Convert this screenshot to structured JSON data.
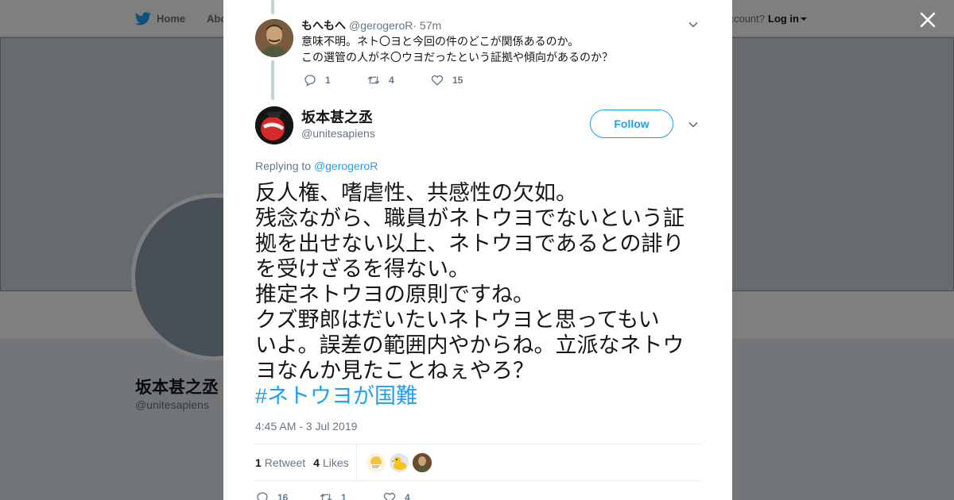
{
  "nav": {
    "home_label": "Home",
    "about_label": "Abo"
  },
  "account": {
    "prompt": "account?",
    "login_label": "Log in"
  },
  "profile": {
    "name": "坂本甚之丞",
    "handle": "@unitesapiens"
  },
  "reply": {
    "name": "もへもへ",
    "handle": "@gerogeroR",
    "time": " · 57m",
    "text_line1": "意味不明。ネト〇ヨと今回の件のどこが関係あるのか。",
    "text_line2": "この選管の人がネ〇ウヨだったという証拠や傾向があるのか？",
    "reply_count": "1",
    "retweet_count": "4",
    "like_count": "15"
  },
  "tweet": {
    "name": "坂本甚之丞",
    "handle": "@unitesapiens",
    "follow_label": "Follow",
    "replying_prefix": "Replying to ",
    "replying_mention": "@gerogeroR",
    "lines": [
      "反人権、嗜虐性、共感性の欠如。",
      "残念ながら、職員がネトウヨでないという証",
      "拠を出せない以上、ネトウヨであるとの誹り",
      "を受けざるを得ない。",
      "推定ネトウヨの原則ですね。",
      "クズ野郎はだいたいネトウヨと思ってもい",
      "いよ。誤差の範囲内やからね。立派なネトウ",
      "ヨなんか見たことねぇやろ？"
    ],
    "hashtag": "#ネトウヨが国難",
    "timestamp": "4:45 AM - 3 Jul 2019",
    "retweets_count": "1",
    "retweets_label": "Retweet",
    "likes_count": "4",
    "likes_label": "Likes",
    "reply_count": "16",
    "retweet_count": "1",
    "like_count": "4"
  },
  "colors": {
    "accent": "#1da1f2",
    "muted": "#657786",
    "text": "#14171a",
    "overlay": "rgba(0,0,0,0.5)"
  }
}
